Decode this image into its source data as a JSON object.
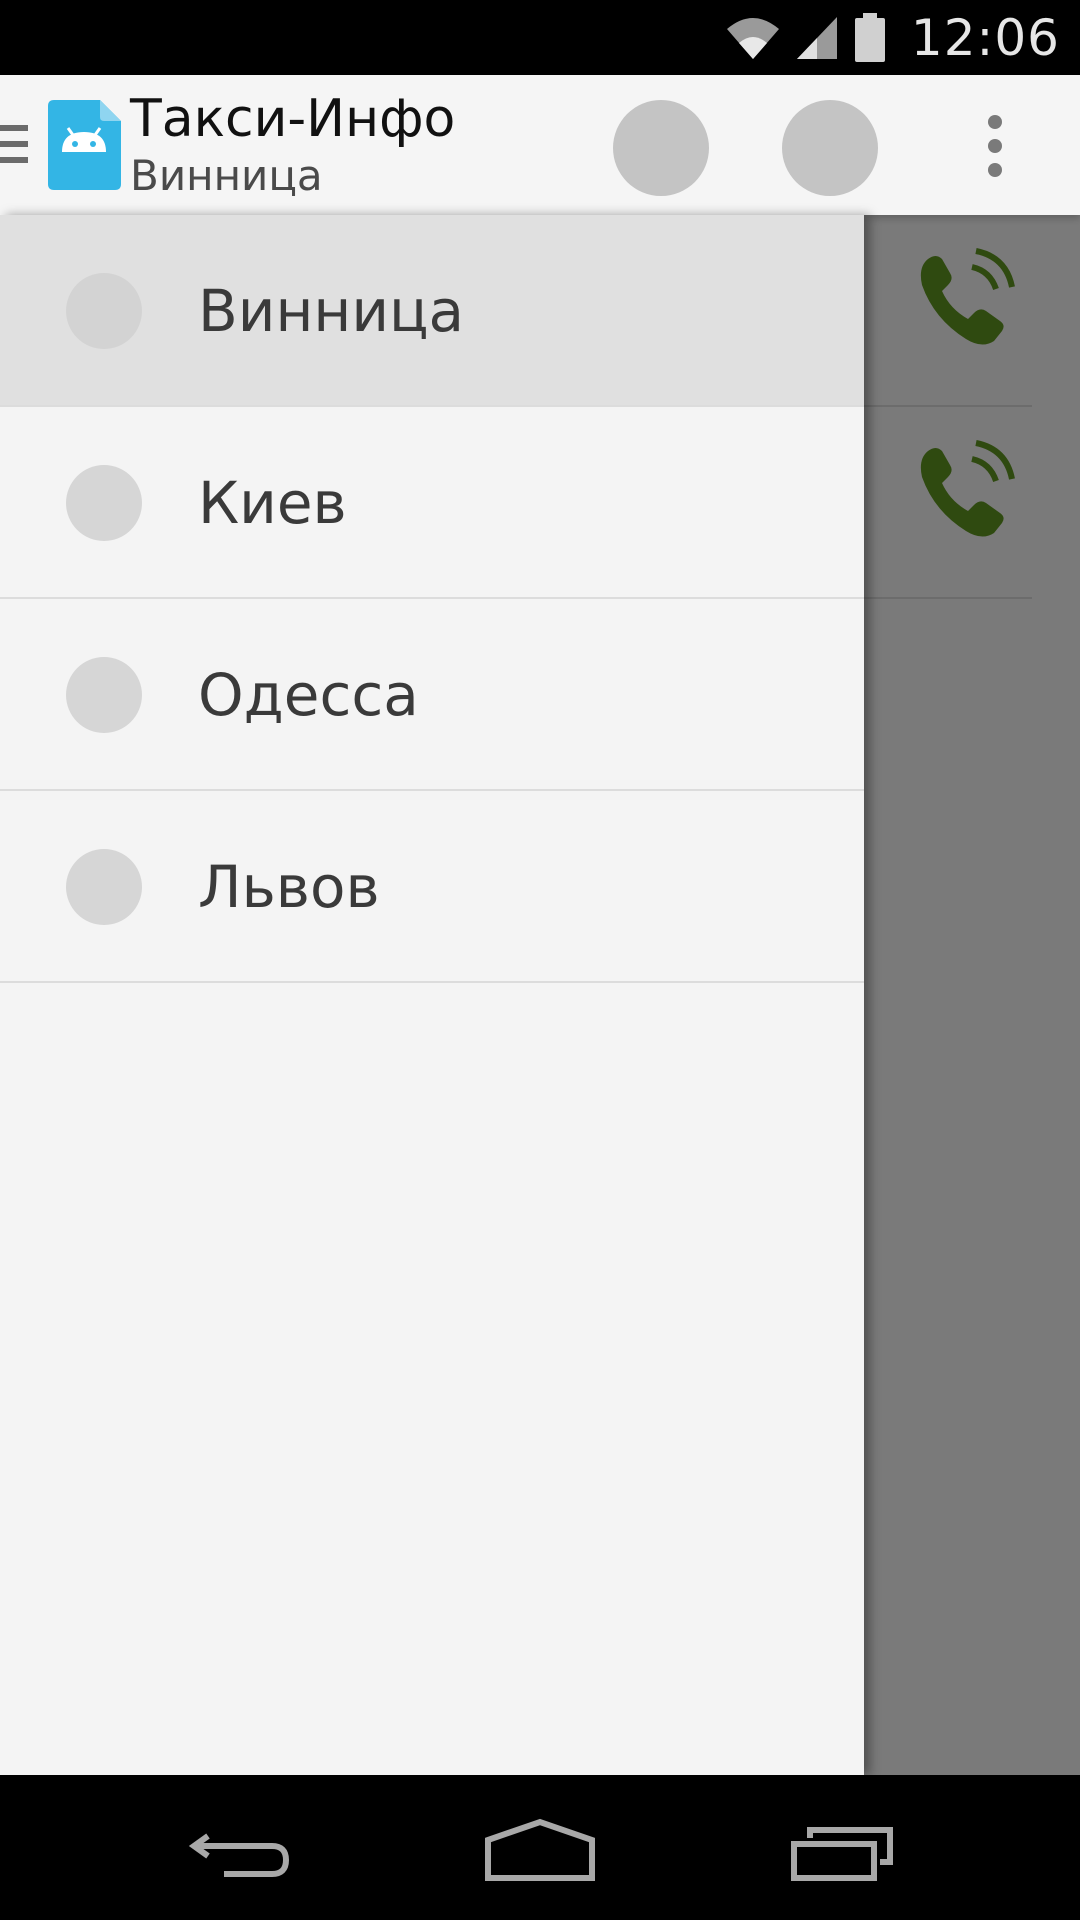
{
  "status_bar": {
    "time": "12:06",
    "icons": [
      "wifi-icon",
      "signal-icon",
      "battery-icon"
    ]
  },
  "action_bar": {
    "title": "Такси-Инфо",
    "subtitle": "Винница",
    "icons": [
      "menu-icon",
      "app-icon",
      "action-1",
      "action-2",
      "overflow-menu-icon"
    ],
    "app_icon_color": "#33b5e5"
  },
  "drawer": {
    "items": [
      {
        "label": "Винница",
        "selected": true
      },
      {
        "label": "Киев",
        "selected": false
      },
      {
        "label": "Одесса",
        "selected": false
      },
      {
        "label": "Львов",
        "selected": false
      }
    ]
  },
  "content": {
    "icons": [
      "phone-icon",
      "phone-icon"
    ],
    "phone_color": "#2f4a10"
  },
  "nav_bar": {
    "icons": [
      "back-icon",
      "home-icon",
      "recents-icon"
    ]
  }
}
